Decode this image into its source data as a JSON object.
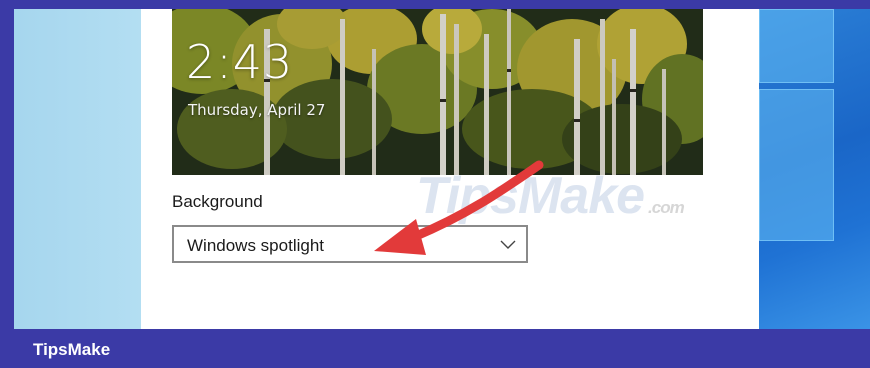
{
  "lockscreen_preview": {
    "time": "2:43",
    "date": "Thursday, April 27"
  },
  "background_setting": {
    "label": "Background",
    "selected": "Windows spotlight"
  },
  "watermark": {
    "text": "TipsMake",
    "suffix": ".com"
  },
  "footer": {
    "brand": "TipsMake"
  },
  "icons": {
    "dropdown": "chevron-down-icon",
    "annotation": "red-arrow-pointer"
  },
  "colors": {
    "footer_bg": "#3b3aa6",
    "arrow": "#e23a3a",
    "desktop_blue": "#1f72d4"
  }
}
